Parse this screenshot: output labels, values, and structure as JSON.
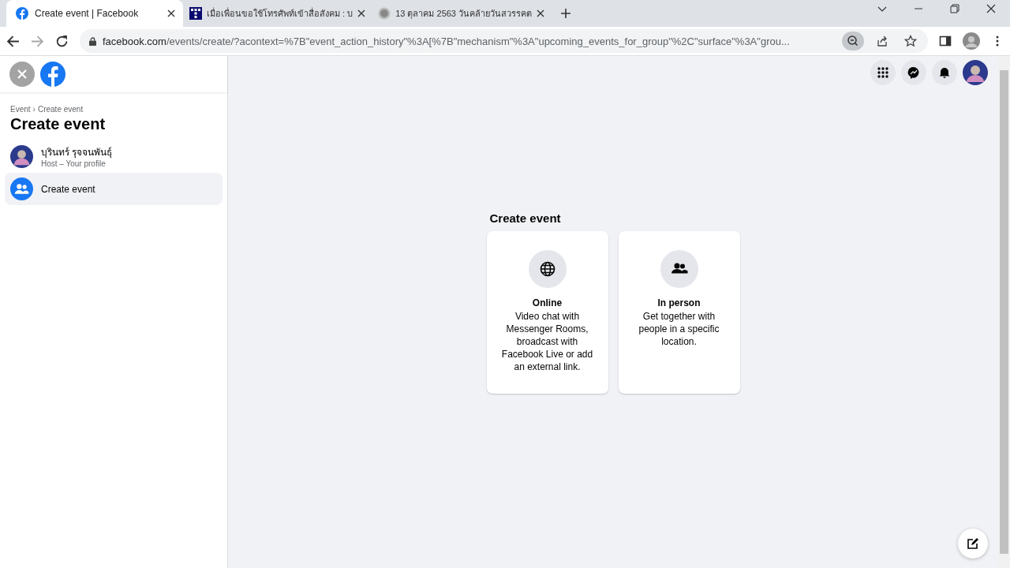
{
  "browser": {
    "tabs": [
      {
        "title": "Create event | Facebook",
        "selected": true
      },
      {
        "title": "เมื่อเพื่อนขอใช้โทรศัพท์เข้าสื่อสังคม : บ",
        "selected": false
      },
      {
        "title": "13 ตุลาคม 2563 วันคล้ายวันสวรรคต",
        "selected": false
      }
    ],
    "url_host": "facebook.com",
    "url_path": "/events/create/?acontext=%7B\"event_action_history\"%3A[%7B\"mechanism\"%3A\"upcoming_events_for_group\"%2C\"surface\"%3A\"grou..."
  },
  "sidebar": {
    "breadcrumb": [
      {
        "label": "Event"
      },
      {
        "label": "Create event"
      }
    ],
    "breadcrumb_separator": "›",
    "title": "Create event",
    "host": {
      "name": "บุรินทร์ รุจจนพันธุ์",
      "subtitle": "Host – Your profile"
    },
    "items": [
      {
        "label": "Create event",
        "selected": true
      }
    ]
  },
  "main": {
    "heading": "Create event",
    "options": [
      {
        "kind": "online",
        "title": "Online",
        "description": "Video chat with Messenger Rooms, broadcast with Facebook Live or add an external link."
      },
      {
        "kind": "in_person",
        "title": "In person",
        "description": "Get together with people in a specific location."
      }
    ]
  }
}
